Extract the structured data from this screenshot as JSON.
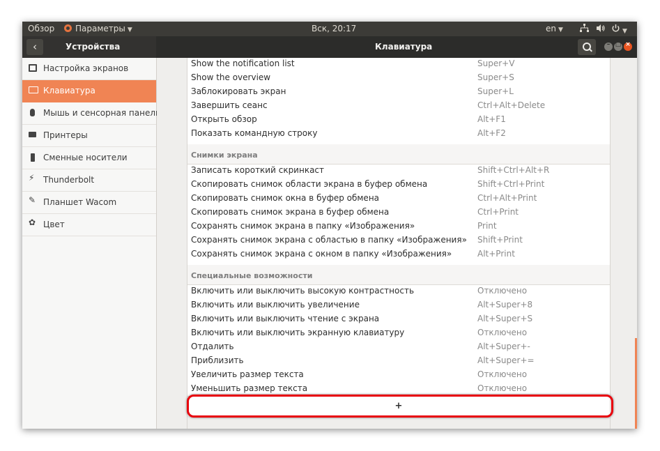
{
  "topbar": {
    "overview": "Обзор",
    "app_menu": "Параметры",
    "clock": "Вск, 20:17",
    "lang": "en"
  },
  "header": {
    "left_title": "Устройства",
    "main_title": "Клавиатура"
  },
  "sidebar": {
    "items": [
      {
        "label": "Настройка экранов",
        "icon": "display-icon"
      },
      {
        "label": "Клавиатура",
        "icon": "keyboard-icon",
        "active": true
      },
      {
        "label": "Мышь и сенсорная панель",
        "icon": "mouse-icon"
      },
      {
        "label": "Принтеры",
        "icon": "printer-icon"
      },
      {
        "label": "Сменные носители",
        "icon": "usb-drive-icon"
      },
      {
        "label": "Thunderbolt",
        "icon": "thunderbolt-icon"
      },
      {
        "label": "Планшет Wacom",
        "icon": "tablet-icon"
      },
      {
        "label": "Цвет",
        "icon": "color-icon"
      }
    ]
  },
  "shortcuts": {
    "system": [
      {
        "name": "Show the notification list",
        "key": "Super+V"
      },
      {
        "name": "Show the overview",
        "key": "Super+S"
      },
      {
        "name": "Заблокировать экран",
        "key": "Super+L"
      },
      {
        "name": "Завершить сеанс",
        "key": "Ctrl+Alt+Delete"
      },
      {
        "name": "Открыть обзор",
        "key": "Alt+F1"
      },
      {
        "name": "Показать командную строку",
        "key": "Alt+F2"
      }
    ],
    "screenshots_title": "Снимки экрана",
    "screenshots": [
      {
        "name": "Записать короткий скринкаст",
        "key": "Shift+Ctrl+Alt+R"
      },
      {
        "name": "Скопировать снимок области экрана в буфер обмена",
        "key": "Shift+Ctrl+Print"
      },
      {
        "name": "Скопировать снимок окна в буфер обмена",
        "key": "Ctrl+Alt+Print"
      },
      {
        "name": "Скопировать снимок экрана в буфер обмена",
        "key": "Ctrl+Print"
      },
      {
        "name": "Сохранять снимок экрана в папку «Изображения»",
        "key": "Print"
      },
      {
        "name": "Сохранять снимок экрана с областью в папку «Изображения»",
        "key": "Shift+Print"
      },
      {
        "name": "Сохранять снимок экрана с окном в папку «Изображения»",
        "key": "Alt+Print"
      }
    ],
    "accessibility_title": "Специальные возможности",
    "accessibility": [
      {
        "name": "Включить или выключить высокую контрастность",
        "key": "Отключено"
      },
      {
        "name": "Включить или выключить увеличение",
        "key": "Alt+Super+8"
      },
      {
        "name": "Включить или выключить чтение с экрана",
        "key": "Alt+Super+S"
      },
      {
        "name": "Включить или выключить экранную клавиатуру",
        "key": "Отключено"
      },
      {
        "name": "Отдалить",
        "key": "Alt+Super+-"
      },
      {
        "name": "Приблизить",
        "key": "Alt+Super+="
      },
      {
        "name": "Увеличить размер текста",
        "key": "Отключено"
      },
      {
        "name": "Уменьшить размер текста",
        "key": "Отключено"
      }
    ],
    "add_label": "+"
  },
  "colors": {
    "accent": "#f08454",
    "topbar": "#3c3b37",
    "highlight": "#e8000b"
  }
}
